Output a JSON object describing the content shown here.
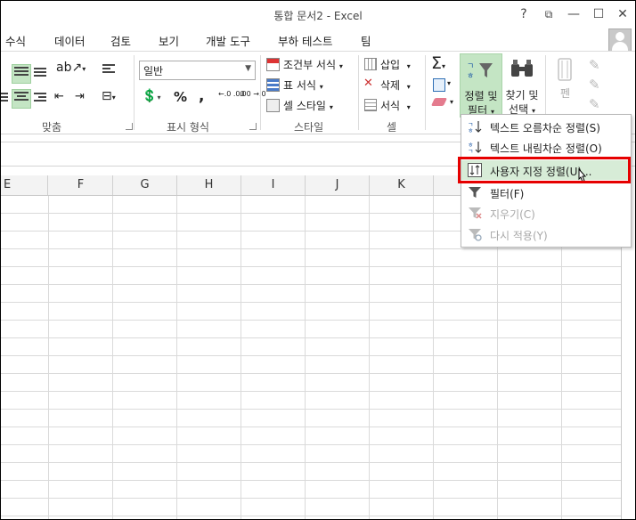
{
  "window": {
    "title": "통합 문서2 - Excel",
    "help": "?",
    "restore": "⧉",
    "minimize": "—",
    "maximize": "☐",
    "close": "✕"
  },
  "menu_tabs": [
    "수식",
    "데이터",
    "검토",
    "보기",
    "개발 도구",
    "부하 테스트",
    "팀"
  ],
  "ribbon": {
    "number_format": "일반",
    "percent": "%",
    "comma": ",",
    "decimal_increase": "←.0 .00",
    "decimal_decrease": ".00 →.0",
    "conditional_format": "조건부 서식",
    "table_format": "표 서식",
    "cell_style": "셀 스타일",
    "insert": "삽입",
    "delete": "삭제",
    "format": "서식",
    "sigma": "Σ",
    "sort_filter_line1": "정렬 및",
    "sort_filter_line2": "필터",
    "find_line1": "찾기 및",
    "find_line2": "선택",
    "pen": "펜",
    "groups": {
      "alignment": "맞춤",
      "number": "표시 형식",
      "styles": "스타일",
      "cells": "셀"
    }
  },
  "columns": [
    "E",
    "F",
    "G",
    "H",
    "I",
    "J",
    "K"
  ],
  "sort_menu": {
    "items": [
      {
        "label": "텍스트 오름차순 정렬(S)",
        "enabled": true,
        "icon": "sort-asc-icon"
      },
      {
        "label": "텍스트 내림차순 정렬(O)",
        "enabled": true,
        "icon": "sort-desc-icon"
      },
      {
        "label": "사용자 지정 정렬(U)...",
        "enabled": true,
        "icon": "custom-sort-icon",
        "highlighted": true
      },
      {
        "label": "필터(F)",
        "enabled": true,
        "icon": "filter-icon"
      },
      {
        "label": "지우기(C)",
        "enabled": false,
        "icon": "clear-filter-icon"
      },
      {
        "label": "다시 적용(Y)",
        "enabled": false,
        "icon": "reapply-icon"
      }
    ]
  },
  "colors": {
    "highlight_red": "#e60000",
    "hover_green": "#c4e5c4",
    "menu_hover": "#d7ecd7"
  }
}
